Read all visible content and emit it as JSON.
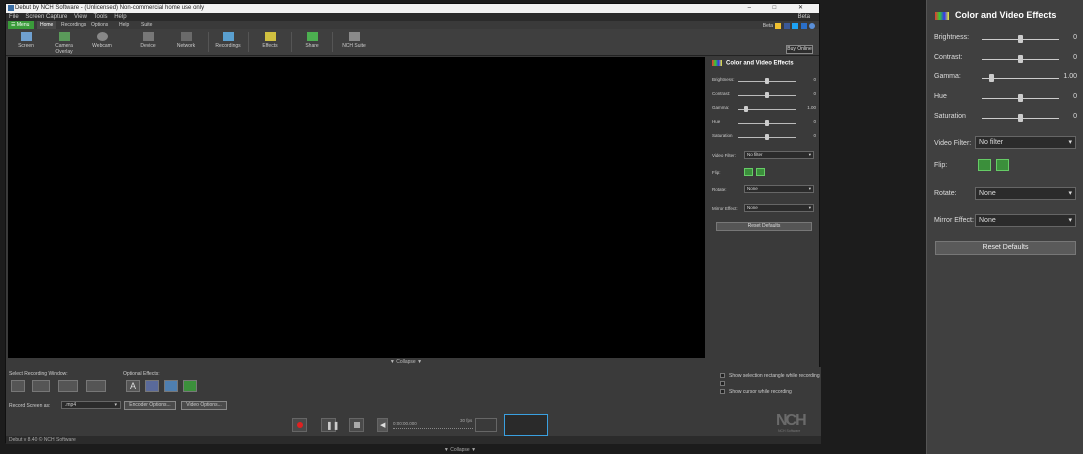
{
  "window": {
    "title": "Debut by NCH Software - (Unlicensed) Non-commercial home use only",
    "controls": [
      "–",
      "□",
      "✕"
    ],
    "beta_label": "Beta"
  },
  "menubar": {
    "items": [
      "File",
      "Screen Capture",
      "View",
      "Tools",
      "Help"
    ],
    "beta": "Beta"
  },
  "ribbon": {
    "menu_label": "☰ Menu ▾",
    "tabs": [
      "Home",
      "Recordings",
      "Options",
      "Help",
      "Suite"
    ],
    "social_label": "Beta"
  },
  "toolbar": {
    "buttons": [
      "Screen",
      "Camera Overlay",
      "Webcam",
      "Device",
      "Network",
      "Recordings",
      "Effects",
      "Share",
      "NCH Suite"
    ],
    "buy_online": "Buy Online"
  },
  "small_panel": {
    "title": "Color and Video Effects",
    "sliders": [
      {
        "label": "Brightness:",
        "value": "0",
        "pos": 0.5
      },
      {
        "label": "Contrast:",
        "value": "0",
        "pos": 0.5
      },
      {
        "label": "Gamma:",
        "value": "1.00",
        "pos": 0.1
      },
      {
        "label": "Hue",
        "value": "0",
        "pos": 0.5
      },
      {
        "label": "Saturation",
        "value": "0",
        "pos": 0.5
      }
    ],
    "video_filter_label": "Video Filter:",
    "video_filter_value": "No filter",
    "flip_label": "Flip:",
    "rotate_label": "Rotate:",
    "rotate_value": "None",
    "mirror_label": "Mirror Effect:",
    "mirror_value": "None",
    "reset": "Reset Defaults"
  },
  "bottom": {
    "collapse": "▼ Collapse ▼",
    "select_window_label": "Select Recording Window:",
    "optional_effects_label": "Optional Effects:",
    "record_as_label": "Record Screen as:",
    "format": ".mp4",
    "encoder_options": "Encoder Options...",
    "video_options": "Video Options...",
    "show_rect": "Show selection rectangle while recording",
    "show_cursor": "Show cursor while recording",
    "timecode": "0:00:00.000",
    "fps": "30 fps",
    "nch_logo": "NCH",
    "nch_sub": "NCH Software"
  },
  "statusbar": {
    "text": "Debut v 8.40 © NCH Software"
  },
  "desktop": {
    "collapse": "▼ Collapse ▼"
  },
  "right_panel": {
    "title": "Color and Video Effects",
    "sliders": [
      {
        "label": "Brightness:",
        "value": "0",
        "pos": 0.5
      },
      {
        "label": "Contrast:",
        "value": "0",
        "pos": 0.5
      },
      {
        "label": "Gamma:",
        "value": "1.00",
        "pos": 0.1
      },
      {
        "label": "Hue",
        "value": "0",
        "pos": 0.5
      },
      {
        "label": "Saturation",
        "value": "0",
        "pos": 0.5
      }
    ],
    "video_filter_label": "Video Filter:",
    "video_filter_value": "No filter",
    "flip_label": "Flip:",
    "rotate_label": "Rotate:",
    "rotate_value": "None",
    "mirror_label": "Mirror Effect:",
    "mirror_value": "None",
    "reset": "Reset Defaults"
  },
  "colors": {
    "accent_green": "#3b8f3b",
    "record_red": "#e02020",
    "highlight_blue": "#3aa0e0"
  }
}
